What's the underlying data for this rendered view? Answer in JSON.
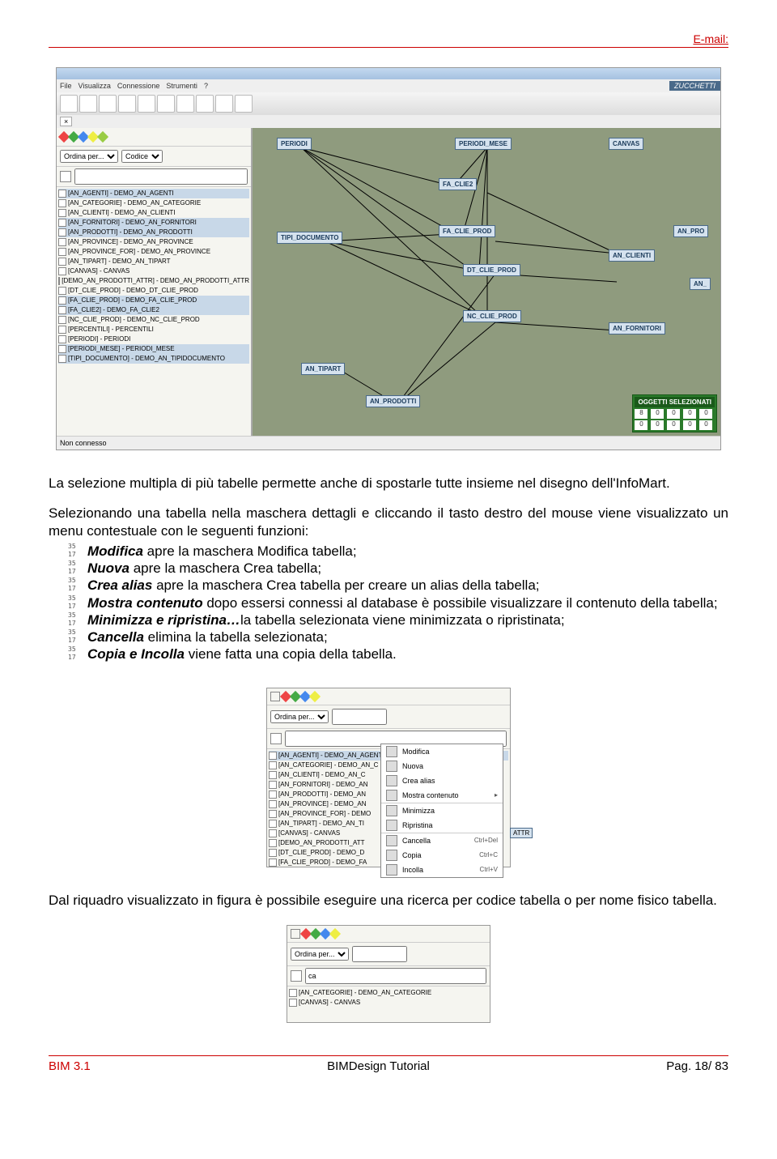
{
  "header": {
    "email_label": "E-mail:"
  },
  "app": {
    "menus": [
      "File",
      "Visualizza",
      "Connessione",
      "Strumenti",
      "?"
    ],
    "brand": "ZUCCHETTI",
    "ordina_label": "Ordina per...",
    "ordina_value": "Codice",
    "status": "Non connesso",
    "tree": [
      "[AN_AGENTI] - DEMO_AN_AGENTI",
      "[AN_CATEGORIE] - DEMO_AN_CATEGORIE",
      "[AN_CLIENTI] - DEMO_AN_CLIENTI",
      "[AN_FORNITORI] - DEMO_AN_FORNITORI",
      "[AN_PRODOTTI] - DEMO_AN_PRODOTTI",
      "[AN_PROVINCE] - DEMO_AN_PROVINCE",
      "[AN_PROVINCE_FOR] - DEMO_AN_PROVINCE",
      "[AN_TIPART] - DEMO_AN_TIPART",
      "[CANVAS] - CANVAS",
      "[DEMO_AN_PRODOTTI_ATTR] - DEMO_AN_PRODOTTI_ATTR",
      "[DT_CLIE_PROD] - DEMO_DT_CLIE_PROD",
      "[FA_CLIE_PROD] - DEMO_FA_CLIE_PROD",
      "[FA_CLIE2] - DEMO_FA_CLIE2",
      "[NC_CLIE_PROD] - DEMO_NC_CLIE_PROD",
      "[PERCENTILI] - PERCENTILI",
      "[PERIODI] - PERIODI",
      "[PERIODI_MESE] - PERIODI_MESE",
      "[TIPI_DOCUMENTO] - DEMO_AN_TIPIDOCUMENTO"
    ],
    "nodes": {
      "periodi": "PERIODI",
      "periodi_mese": "PERIODI_MESE",
      "canvas": "CANVAS",
      "fa_clie2": "FA_CLIE2",
      "tipi_documento": "TIPI_DOCUMENTO",
      "fa_clie_prod": "FA_CLIE_PROD",
      "an_pro": "AN_PRO",
      "dt_clie_prod": "DT_CLIE_PROD",
      "an_clienti": "AN_CLIENTI",
      "nc_clie_prod": "NC_CLIE_PROD",
      "an": "AN_",
      "an_fornitori": "AN_FORNITORI",
      "an_tipart": "AN_TIPART",
      "an_prodotti": "AN_PRODOTTI"
    },
    "sel_panel_title": "OGGETTI SELEZIONATI",
    "sel_values": [
      "8",
      "0",
      "0",
      "0",
      "0",
      "0",
      "0",
      "0",
      "0",
      "0"
    ]
  },
  "para1": "La selezione multipla di più tabelle permette anche di spostarle tutte insieme nel disegno dell'InfoMart.",
  "para2": "Selezionando una tabella nella maschera dettagli e cliccando il tasto destro del mouse viene visualizzato un menu contestuale con le seguenti funzioni:",
  "funcs": [
    {
      "name": "Modifica",
      "desc": "  apre la maschera Modifica tabella;"
    },
    {
      "name": "Nuova",
      "desc": "      apre la maschera Crea tabella;"
    },
    {
      "name": "Crea alias",
      "desc": "  apre la maschera Crea tabella per creare un alias della tabella;"
    },
    {
      "name": "Mostra contenuto",
      "desc": "   dopo essersi connessi al database è possibile visualizzare il contenuto della tabella;"
    },
    {
      "name": "Minimizza e ripristina…",
      "desc": "la tabella selezionata viene minimizzata o ripristinata;"
    },
    {
      "name": "Cancella",
      "desc": "  elimina la tabella selezionata;"
    },
    {
      "name": "Copia e Incolla",
      "desc": "  viene fatta una copia della tabella."
    }
  ],
  "context": {
    "tree": [
      "[AN_AGENTI] - DEMO_AN_AGENTI",
      "[AN_CATEGORIE] - DEMO_AN_C",
      "[AN_CLIENTI] - DEMO_AN_C",
      "[AN_FORNITORI] - DEMO_AN",
      "[AN_PRODOTTI] - DEMO_AN",
      "[AN_PROVINCE] - DEMO_AN",
      "[AN_PROVINCE_FOR] - DEMO",
      "[AN_TIPART] - DEMO_AN_TI",
      "[CANVAS] - CANVAS",
      "[DEMO_AN_PRODOTTI_ATT",
      "[DT_CLIE_PROD] - DEMO_D",
      "[FA_CLIE_PROD] - DEMO_FA"
    ],
    "menu": [
      {
        "label": "Modifica",
        "shortcut": ""
      },
      {
        "label": "Nuova",
        "shortcut": ""
      },
      {
        "label": "Crea alias",
        "shortcut": ""
      },
      {
        "label": "Mostra contenuto",
        "shortcut": "▸"
      },
      {
        "label": "Minimizza",
        "shortcut": ""
      },
      {
        "label": "Ripristina",
        "shortcut": ""
      },
      {
        "label": "Cancella",
        "shortcut": "Ctrl+Del"
      },
      {
        "label": "Copia",
        "shortcut": "Ctrl+C"
      },
      {
        "label": "Incolla",
        "shortcut": "Ctrl+V"
      }
    ],
    "attr_label": "ATTR"
  },
  "small_search": {
    "value": "ca",
    "results": [
      "[AN_CATEGORIE] - DEMO_AN_CATEGORIE",
      "[CANVAS] - CANVAS"
    ]
  },
  "para3": "Dal riquadro visualizzato in figura è possibile eseguire una ricerca per codice tabella o per nome fisico tabella.",
  "footer": {
    "left": "BIM 3.1",
    "center": "BIMDesign Tutorial",
    "right": "Pag. 18/ 83"
  }
}
